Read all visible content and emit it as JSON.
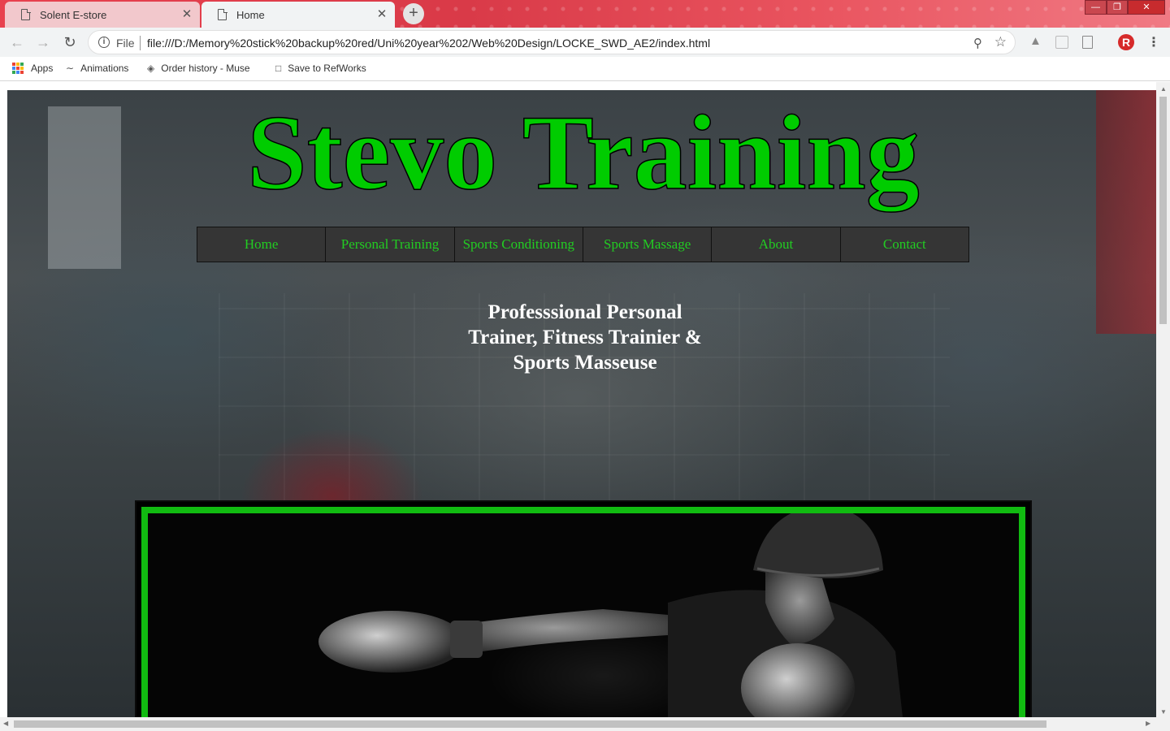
{
  "browser": {
    "tabs": [
      {
        "title": "Solent E-store",
        "active": false
      },
      {
        "title": "Home",
        "active": true
      }
    ],
    "close_glyph": "✕",
    "new_tab_glyph": "+",
    "address": {
      "scheme_label": "File",
      "url": "file:///D:/Memory%20stick%20backup%20red/Uni%20year%202/Web%20Design/LOCKE_SWD_AE2/index.html"
    },
    "profile_initial": "R",
    "bookmarks": [
      {
        "label": "Apps",
        "icon": "apps-grid-icon"
      },
      {
        "label": "Animations",
        "icon": "animations-icon"
      },
      {
        "label": "Order history - Muse",
        "icon": "muse-icon"
      },
      {
        "label": "Save to RefWorks",
        "icon": "page-icon"
      }
    ],
    "accent_color": "#e8414e"
  },
  "site": {
    "title": "Stevo Training",
    "nav": [
      "Home",
      "Personal Training",
      "Sports Conditioning",
      "Sports Massage",
      "About",
      "Contact"
    ],
    "tagline": "Professsional Personal Trainer, Fitness Trainier & Sports Masseuse",
    "title_color": "#00cc00",
    "nav_text_color": "#22cc22",
    "frame_color": "#11bb11",
    "feature_image": "boxer-punching-photo"
  }
}
